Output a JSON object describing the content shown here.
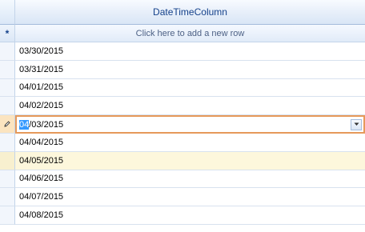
{
  "grid": {
    "column_header": "DateTimeColumn",
    "new_row_indicator": "*",
    "new_row_text": "Click here to add a new row",
    "rows": [
      {
        "value": "03/30/2015",
        "state": "normal"
      },
      {
        "value": "03/31/2015",
        "state": "normal"
      },
      {
        "value": "04/01/2015",
        "state": "normal"
      },
      {
        "value": "04/02/2015",
        "state": "normal"
      },
      {
        "value": "04/03/2015",
        "state": "editing",
        "selected_part": "04",
        "rest_part": "/03/2015"
      },
      {
        "value": "04/04/2015",
        "state": "normal"
      },
      {
        "value": "04/05/2015",
        "state": "hover"
      },
      {
        "value": "04/06/2015",
        "state": "normal"
      },
      {
        "value": "04/07/2015",
        "state": "normal"
      },
      {
        "value": "04/08/2015",
        "state": "normal"
      }
    ]
  },
  "colors": {
    "header_text": "#15428b",
    "edit_border": "#e6995a",
    "hover_row": "#fdf7dc",
    "selection": "#3399ff"
  },
  "icons": {
    "edit_indicator": "pencil-icon",
    "dropdown": "chevron-down-icon"
  }
}
